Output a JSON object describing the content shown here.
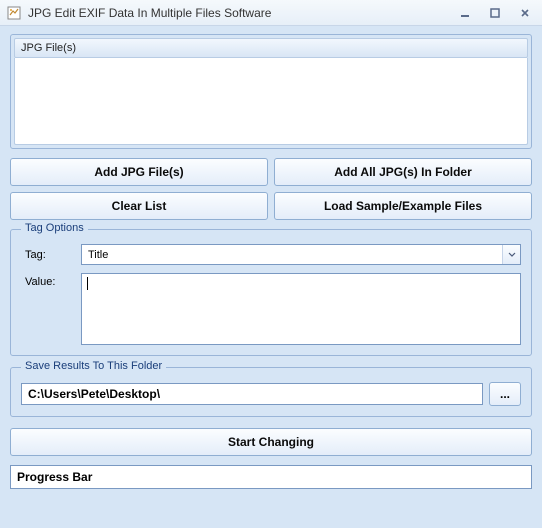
{
  "window": {
    "title": "JPG Edit EXIF Data In Multiple Files Software"
  },
  "files": {
    "header": "JPG File(s)"
  },
  "buttons": {
    "add_files": "Add JPG File(s)",
    "add_folder": "Add All JPG(s) In Folder",
    "clear": "Clear List",
    "load_sample": "Load Sample/Example Files"
  },
  "tag_options": {
    "legend": "Tag Options",
    "tag_label": "Tag:",
    "tag_value": "Title",
    "value_label": "Value:",
    "value_text": ""
  },
  "save": {
    "legend": "Save Results To This Folder",
    "path": "C:\\Users\\Pete\\Desktop\\",
    "browse": "..."
  },
  "start": {
    "label": "Start Changing"
  },
  "progress": {
    "label": "Progress Bar"
  }
}
